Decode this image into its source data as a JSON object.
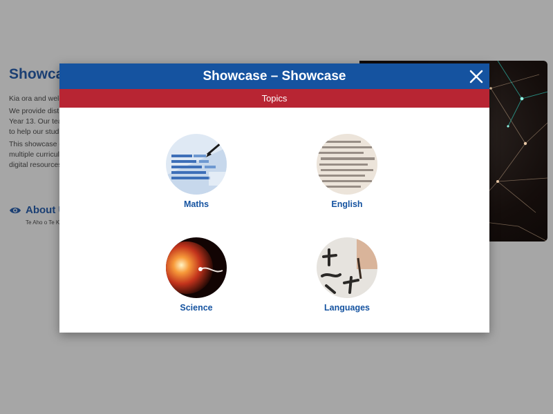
{
  "background": {
    "title": "Showca",
    "paragraphs": [
      "Kia ora and welc",
      "We provide dist",
      "Year 13. Our tea",
      "to help our stud",
      "This showcase c",
      "multiple curricul",
      "digital resources"
    ],
    "about_label": "About U",
    "about_sub": "Te Aho o Te K"
  },
  "modal": {
    "title": "Showcase – Showcase",
    "subtitle": "Topics",
    "close_icon": "close-icon",
    "topics": [
      {
        "label": "Maths",
        "icon": "maths-image"
      },
      {
        "label": "English",
        "icon": "english-image"
      },
      {
        "label": "Science",
        "icon": "science-image"
      },
      {
        "label": "Languages",
        "icon": "languages-image"
      }
    ]
  },
  "colors": {
    "header_blue": "#1553a0",
    "topics_red": "#b82533",
    "overlay_grey": "#a6a6a6"
  }
}
